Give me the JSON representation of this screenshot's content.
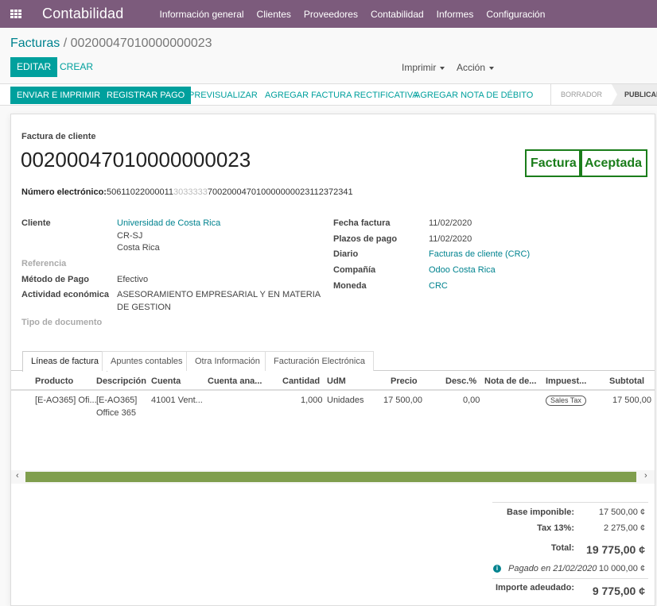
{
  "navbar": {
    "brand": "Contabilidad",
    "items": [
      "Información general",
      "Clientes",
      "Proveedores",
      "Contabilidad",
      "Informes",
      "Configuración"
    ]
  },
  "breadcrumb": {
    "parent": "Facturas",
    "separator": "/",
    "current": "00200047010000000023"
  },
  "buttons": {
    "edit": "EDITAR",
    "create": "CREAR",
    "print": "Imprimir",
    "action": "Acción"
  },
  "statusbar": {
    "send_print": "ENVIAR E IMPRIMIR",
    "register_payment": "REGISTRAR PAGO",
    "preview": "PREVISUALIZAR",
    "add_refund": "AGREGAR FACTURA RECTIFICATIVA",
    "add_debit": "AGREGAR NOTA DE DÉBITO",
    "stages": [
      "BORRADOR",
      "PUBLICADO"
    ],
    "active_stage": "PUBLICADO"
  },
  "document": {
    "type_label": "Factura de cliente",
    "name": "00200047010000000023",
    "badge_type": "Factura",
    "badge_status": "Aceptada",
    "electronic_label": "Número electrónico:",
    "electronic_prefix": "50611022000011",
    "electronic_hidden": "3033333",
    "electronic_suffix": "700200047010000000023112372341",
    "badge_color": "#1a7d1a"
  },
  "fields_left": {
    "customer_label": "Cliente",
    "customer_name": "Universidad de Costa Rica",
    "customer_city": "CR-SJ",
    "customer_country": "Costa Rica",
    "reference_label": "Referencia",
    "payment_method_label": "Método de Pago",
    "payment_method": "Efectivo",
    "activity_label": "Actividad económica",
    "activity_line1": "ASESORAMIENTO EMPRESARIAL Y EN MATERIA",
    "activity_line2": "DE GESTION",
    "doc_type_label": "Tipo de documento"
  },
  "fields_right": {
    "date_label": "Fecha factura",
    "date": "11/02/2020",
    "terms_label": "Plazos de pago",
    "terms": "11/02/2020",
    "journal_label": "Diario",
    "journal": "Facturas de cliente (CRC)",
    "company_label": "Compañía",
    "company": "Odoo Costa Rica",
    "currency_label": "Moneda",
    "currency": "CRC"
  },
  "tabs": [
    "Líneas de factura",
    "Apuntes contables",
    "Otra Información",
    "Facturación Electrónica"
  ],
  "table": {
    "headers": [
      "Producto",
      "Descripción",
      "Cuenta",
      "Cuenta ana...",
      "Cantidad",
      "UdM",
      "Precio",
      "Desc.%",
      "Nota de de...",
      "Impuest...",
      "Subtotal"
    ],
    "rows": [
      {
        "product": "[E-AO365] Ofi...",
        "desc_line1": "[E-AO365]",
        "desc_line2": "Office 365",
        "account": "41001 Vent...",
        "analytic": "",
        "quantity": "1,000",
        "uom": "Unidades",
        "price": "17 500,00",
        "discount": "0,00",
        "note": "",
        "tax": "Sales Tax",
        "subtotal": "17 500,00"
      }
    ]
  },
  "totals": {
    "base_label": "Base imponible:",
    "base_value": "17 500,00 ¢",
    "tax_label": "Tax 13%:",
    "tax_value": "2 275,00 ¢",
    "total_label": "Total:",
    "total_value": "19 775,00 ¢",
    "paid_label": "Pagado en 21/02/2020",
    "paid_value": "10 000,00 ¢",
    "due_label": "Importe adeudado:",
    "due_value": "9 775,00 ¢"
  },
  "colors": {
    "navbar": "#7c5b7c",
    "primary": "#00a09d",
    "link": "#00838f",
    "scroll": "#7f9e4d"
  }
}
